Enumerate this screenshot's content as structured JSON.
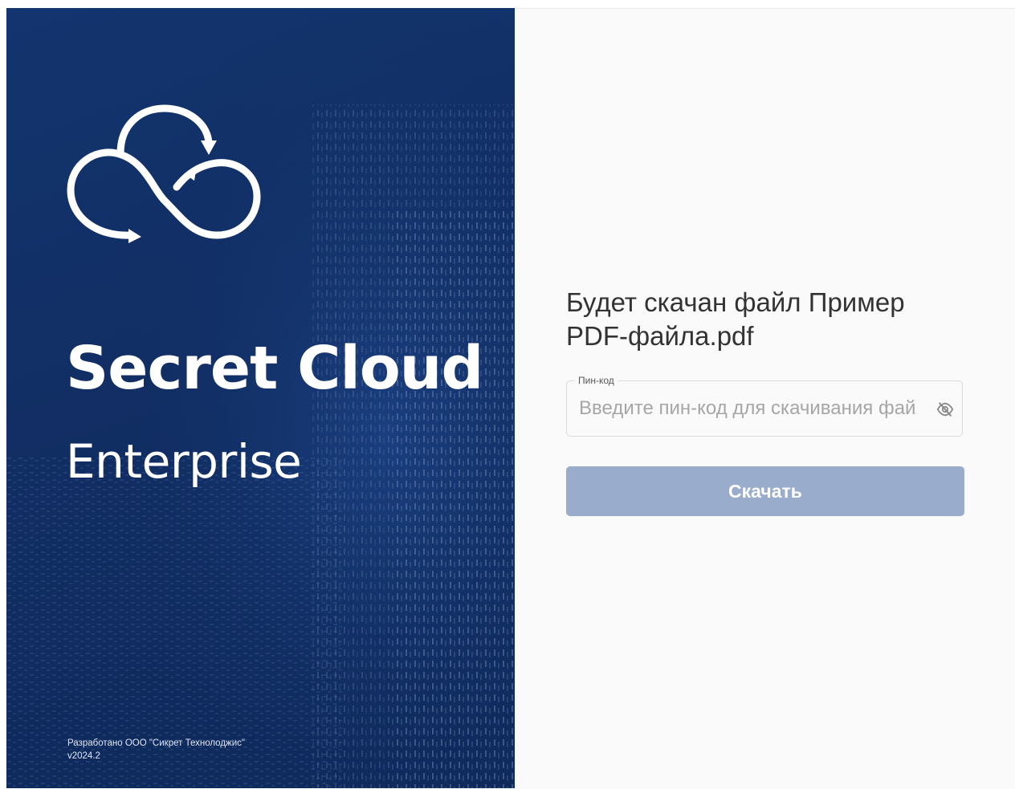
{
  "brand": {
    "title": "Secret Cloud",
    "subtitle": "Enterprise",
    "developer": "Разработано ООО \"Сикрет Технолоджис\"",
    "version": "v2024.2"
  },
  "download": {
    "message": "Будет скачан файл Пример PDF-файла.pdf",
    "pin_label": "Пин-код",
    "pin_placeholder": "Введите пин-код для скачивания файла",
    "pin_value": "",
    "button_label": "Скачать"
  },
  "icons": {
    "logo": "cloud-infinity-logo",
    "visibility": "eye-off-icon"
  },
  "colors": {
    "hero_background": "#14336b",
    "button_disabled": "#9aaccb",
    "text_primary": "#333333"
  }
}
